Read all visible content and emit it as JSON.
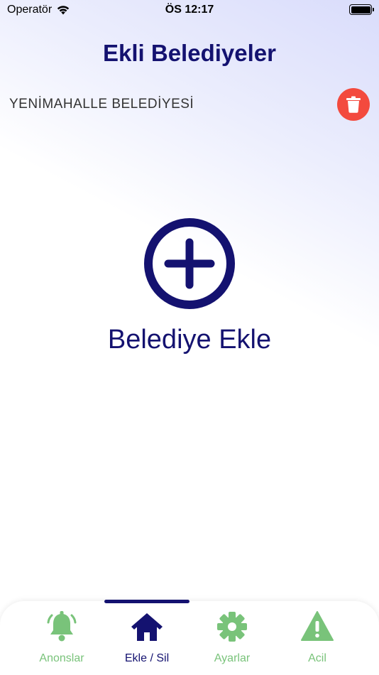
{
  "status_bar": {
    "carrier": "Operatör",
    "time": "ÖS 12:17"
  },
  "page": {
    "title": "Ekli Belediyeler"
  },
  "municipalities": [
    {
      "name": "YENİMAHALLE BELEDİYESİ"
    }
  ],
  "add_section": {
    "label": "Belediye Ekle"
  },
  "tabs": [
    {
      "label": "Anonslar",
      "icon": "bell-icon",
      "active": false
    },
    {
      "label": "Ekle / Sil",
      "icon": "home-icon",
      "active": true
    },
    {
      "label": "Ayarlar",
      "icon": "gear-icon",
      "active": false
    },
    {
      "label": "Acil",
      "icon": "warning-icon",
      "active": false
    }
  ],
  "colors": {
    "primary": "#141270",
    "danger": "#f34a3e",
    "tab_inactive": "#79c37a"
  }
}
